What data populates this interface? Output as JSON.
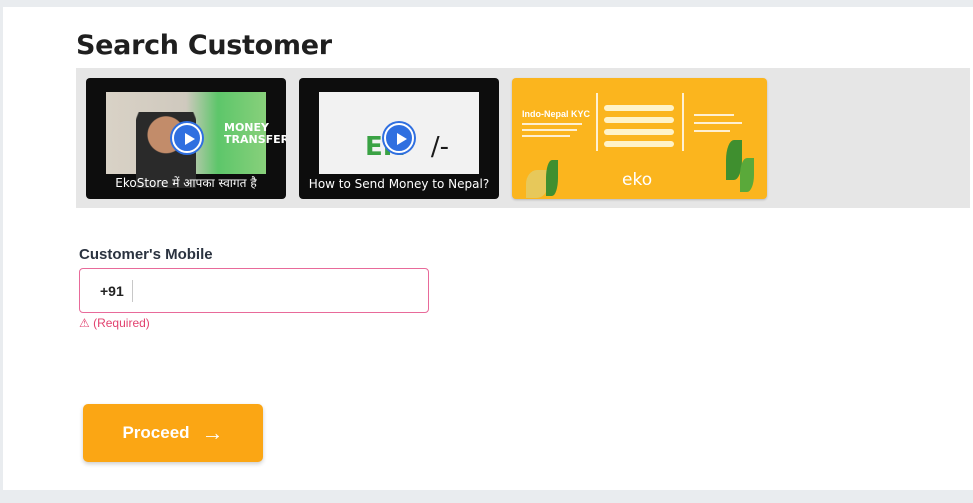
{
  "page": {
    "title": "Search Customer"
  },
  "videos": [
    {
      "caption": "EkoStore में आपका स्वागत है",
      "overlay_text": "MONEY\nTRANSFER"
    },
    {
      "caption": "How to Send Money to Nepal?",
      "logo_text": "EK",
      "logo_suffix": "/-"
    },
    {
      "title": "Indo-Nepal KYC",
      "brand": "eko"
    }
  ],
  "form": {
    "mobile_label": "Customer's Mobile",
    "country_code": "+91",
    "mobile_value": "",
    "mobile_placeholder": "",
    "error_text": "⚠ (Required)"
  },
  "actions": {
    "proceed_label": "Proceed",
    "proceed_icon": "arrow-right-icon"
  },
  "colors": {
    "accent": "#fba614",
    "error": "#e2426f",
    "kyc_bg": "#fbb51e"
  }
}
